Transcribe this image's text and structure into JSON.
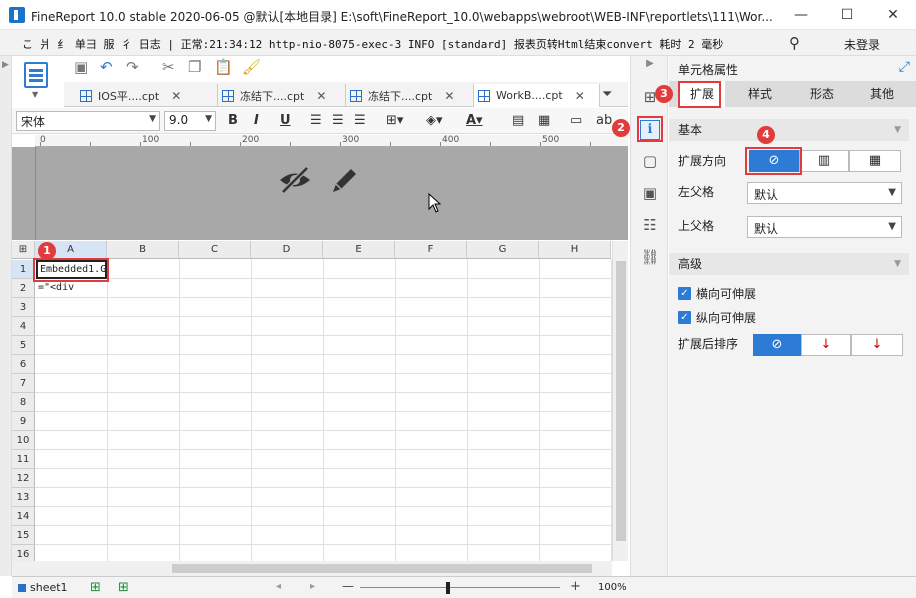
{
  "window": {
    "title": "FineReport 10.0 stable 2020-06-05 @默认[本地目录]    E:\\soft\\FineReport_10.0\\webapps\\webroot\\WEB-INF\\reportlets\\111\\Wor...",
    "min": "—",
    "max": "☐",
    "close": "✕"
  },
  "logbar": {
    "text": "こ 爿 纟 单彐 服 彳 日志 | 正常:21:34:12 http-nio-8075-exec-3 INFO [standard] 报表页转Html结束convert  耗时 2 毫秒",
    "search_icon": "⚲",
    "login": "未登录"
  },
  "tabs": [
    {
      "label": "IOS平....cpt",
      "close": "✕"
    },
    {
      "label": "冻结下....cpt",
      "close": "✕"
    },
    {
      "label": "冻结下....cpt",
      "close": "✕"
    },
    {
      "label": "WorkB....cpt",
      "close": "✕"
    }
  ],
  "format": {
    "font": "宋体",
    "size": "9.0",
    "bold": "B",
    "italic": "I",
    "underline": "U"
  },
  "ruler": [
    "0",
    "100",
    "200",
    "300",
    "400",
    "500"
  ],
  "grid": {
    "columns": [
      "A",
      "B",
      "C",
      "D",
      "E",
      "F",
      "G",
      "H"
    ],
    "rows": [
      "1",
      "2",
      "3",
      "4",
      "5",
      "6",
      "7",
      "8",
      "9",
      "10",
      "11",
      "12",
      "13",
      "14",
      "15",
      "16"
    ],
    "a1": "Embedded1.G",
    "a2": "=\"<div"
  },
  "badges": [
    "1",
    "2",
    "3",
    "4"
  ],
  "bottom": {
    "sheet": "sheet1",
    "zoom": "100%",
    "minus": "—",
    "plus": "+"
  },
  "panel": {
    "title": "单元格属性",
    "tabs": [
      "扩展",
      "样式",
      "形态",
      "其他"
    ],
    "basic": "基本",
    "direction_label": "扩展方向",
    "left_parent_label": "左父格",
    "left_parent_value": "默认",
    "top_parent_label": "上父格",
    "top_parent_value": "默认",
    "advanced": "高级",
    "horizontal": "横向可伸展",
    "vertical": "纵向可伸展",
    "sort_label": "扩展后排序"
  }
}
